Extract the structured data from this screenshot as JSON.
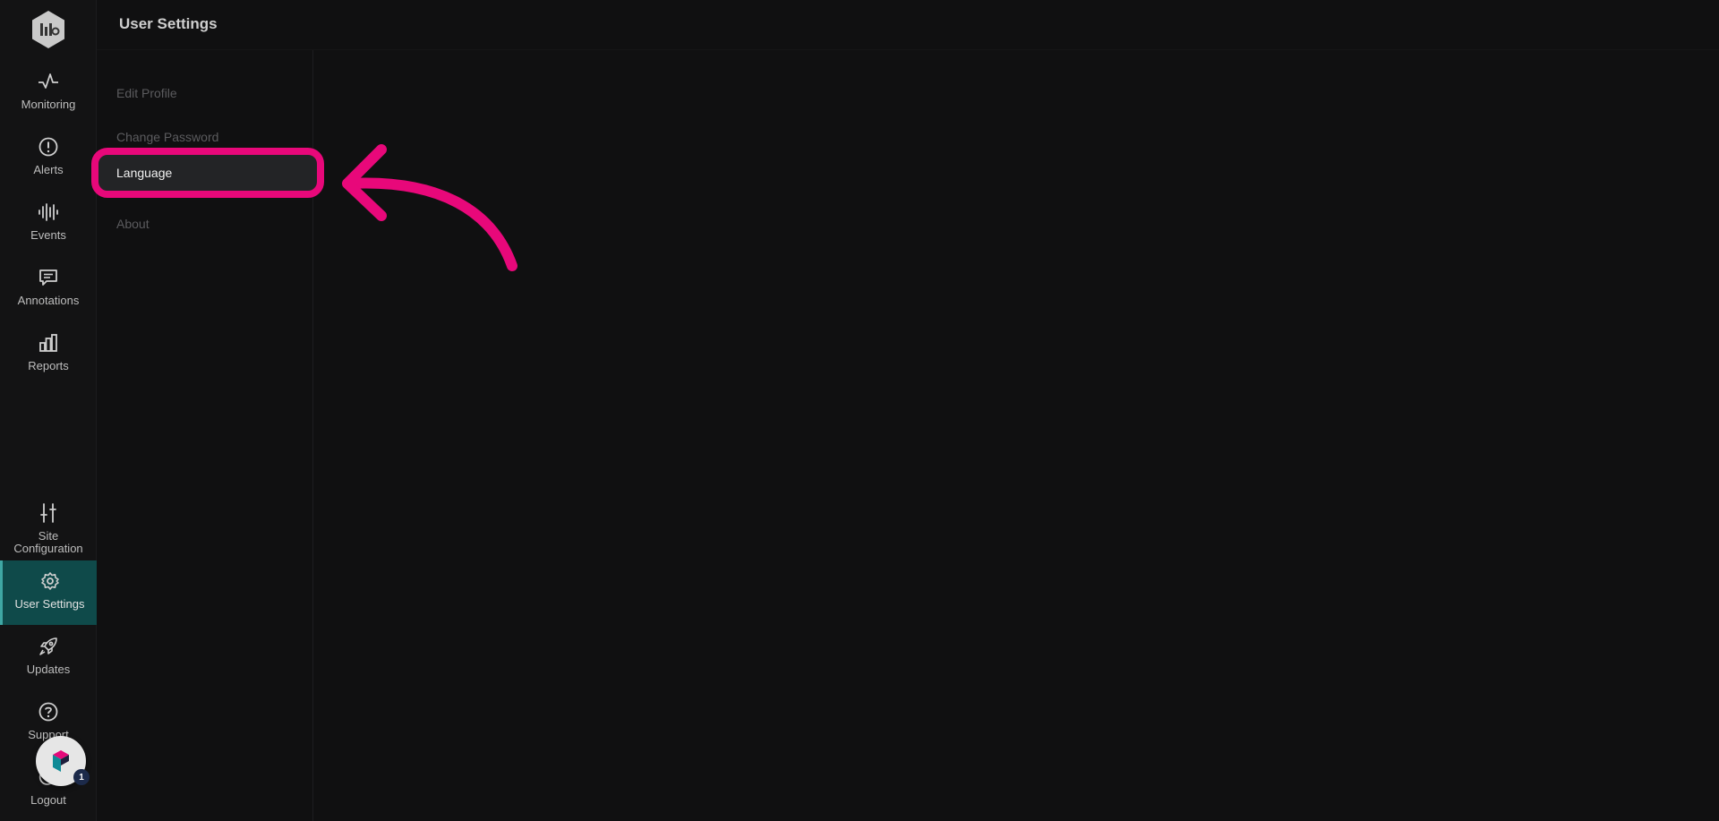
{
  "header": {
    "title": "User Settings"
  },
  "sidebar": {
    "top_items": [
      {
        "label": "Monitoring",
        "icon": "pulse-icon"
      },
      {
        "label": "Alerts",
        "icon": "alert-icon"
      },
      {
        "label": "Events",
        "icon": "waveform-icon"
      },
      {
        "label": "Annotations",
        "icon": "comment-icon"
      },
      {
        "label": "Reports",
        "icon": "bar-chart-icon"
      }
    ],
    "bottom_items": [
      {
        "label": "Site Configuration",
        "icon": "sliders-icon"
      },
      {
        "label": "User Settings",
        "icon": "gear-icon",
        "active": true
      },
      {
        "label": "Updates",
        "icon": "rocket-icon"
      },
      {
        "label": "Support",
        "icon": "help-icon"
      },
      {
        "label": "Logout",
        "icon": "logout-icon"
      }
    ]
  },
  "settings_menu": {
    "items": [
      {
        "label": "Edit Profile"
      },
      {
        "label": "Change Password"
      },
      {
        "label": "Language",
        "selected": true
      },
      {
        "label": "About"
      }
    ]
  },
  "badge": {
    "count": "1"
  },
  "colors": {
    "background": "#101011",
    "active_nav": "#0f4a4a",
    "active_nav_border": "#3fa7a4",
    "highlight": "#e8087a"
  }
}
